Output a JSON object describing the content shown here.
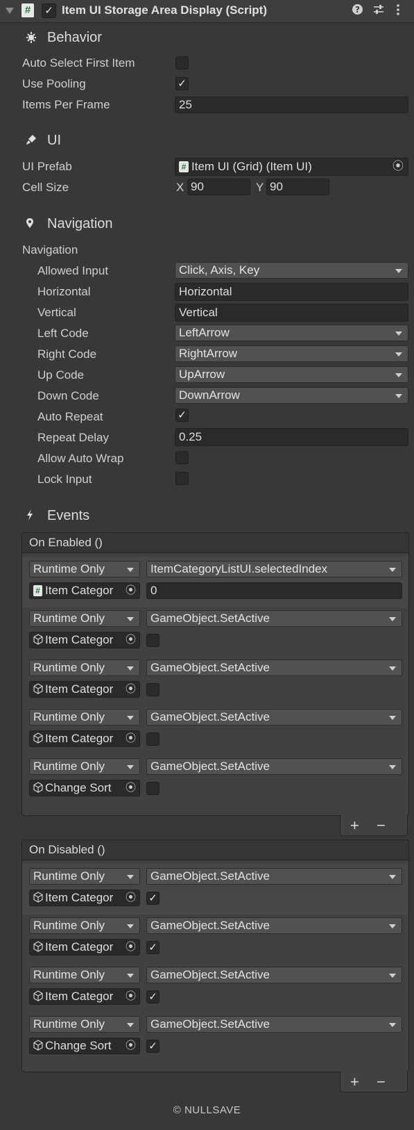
{
  "header": {
    "title": "Item UI Storage Area Display (Script)",
    "script_icon": "#",
    "enabled": true,
    "icons": [
      "help-icon",
      "presets-icon",
      "menu-icon"
    ]
  },
  "behavior": {
    "title": "Behavior",
    "icon": "gear-icon",
    "auto_select_label": "Auto Select First Item",
    "auto_select": false,
    "use_pooling_label": "Use Pooling",
    "use_pooling": true,
    "items_per_frame_label": "Items Per Frame",
    "items_per_frame": "25"
  },
  "ui": {
    "title": "UI",
    "icon": "brush-icon",
    "prefab_label": "UI Prefab",
    "prefab_value": "Item UI (Grid) (Item UI)",
    "cell_size_label": "Cell Size",
    "x_label": "X",
    "x_value": "90",
    "y_label": "Y",
    "y_value": "90"
  },
  "navigation": {
    "title": "Navigation",
    "icon": "map-pin-icon",
    "group_label": "Navigation",
    "allowed_input_label": "Allowed Input",
    "allowed_input": "Click, Axis, Key",
    "horizontal_label": "Horizontal",
    "horizontal": "Horizontal",
    "vertical_label": "Vertical",
    "vertical": "Vertical",
    "left_code_label": "Left Code",
    "left_code": "LeftArrow",
    "right_code_label": "Right Code",
    "right_code": "RightArrow",
    "up_code_label": "Up Code",
    "up_code": "UpArrow",
    "down_code_label": "Down Code",
    "down_code": "DownArrow",
    "auto_repeat_label": "Auto Repeat",
    "auto_repeat": true,
    "repeat_delay_label": "Repeat Delay",
    "repeat_delay": "0.25",
    "allow_auto_wrap_label": "Allow Auto Wrap",
    "allow_auto_wrap": false,
    "lock_input_label": "Lock Input",
    "lock_input": false
  },
  "events": {
    "title": "Events",
    "icon": "lightning-icon",
    "on_enabled": {
      "label": "On Enabled ()",
      "entries": [
        {
          "mode": "Runtime Only",
          "function": "ItemCategoryListUI.selectedIndex",
          "target": "Item Categor",
          "target_icon": "script",
          "arg_type": "text",
          "arg": "0"
        },
        {
          "mode": "Runtime Only",
          "function": "GameObject.SetActive",
          "target": "Item Categor",
          "target_icon": "cube",
          "arg_type": "bool",
          "arg": false
        },
        {
          "mode": "Runtime Only",
          "function": "GameObject.SetActive",
          "target": "Item Categor",
          "target_icon": "cube",
          "arg_type": "bool",
          "arg": false
        },
        {
          "mode": "Runtime Only",
          "function": "GameObject.SetActive",
          "target": "Item Categor",
          "target_icon": "cube",
          "arg_type": "bool",
          "arg": false
        },
        {
          "mode": "Runtime Only",
          "function": "GameObject.SetActive",
          "target": "Change Sort",
          "target_icon": "cube",
          "arg_type": "bool",
          "arg": false
        }
      ]
    },
    "on_disabled": {
      "label": "On Disabled ()",
      "entries": [
        {
          "mode": "Runtime Only",
          "function": "GameObject.SetActive",
          "target": "Item Categor",
          "target_icon": "cube",
          "arg_type": "bool",
          "arg": true
        },
        {
          "mode": "Runtime Only",
          "function": "GameObject.SetActive",
          "target": "Item Categor",
          "target_icon": "cube",
          "arg_type": "bool",
          "arg": true
        },
        {
          "mode": "Runtime Only",
          "function": "GameObject.SetActive",
          "target": "Item Categor",
          "target_icon": "cube",
          "arg_type": "bool",
          "arg": true
        },
        {
          "mode": "Runtime Only",
          "function": "GameObject.SetActive",
          "target": "Change Sort",
          "target_icon": "cube",
          "arg_type": "bool",
          "arg": true
        }
      ]
    },
    "add_label": "+",
    "remove_label": "−"
  },
  "footer": {
    "copyright": "© NULLSAVE"
  }
}
